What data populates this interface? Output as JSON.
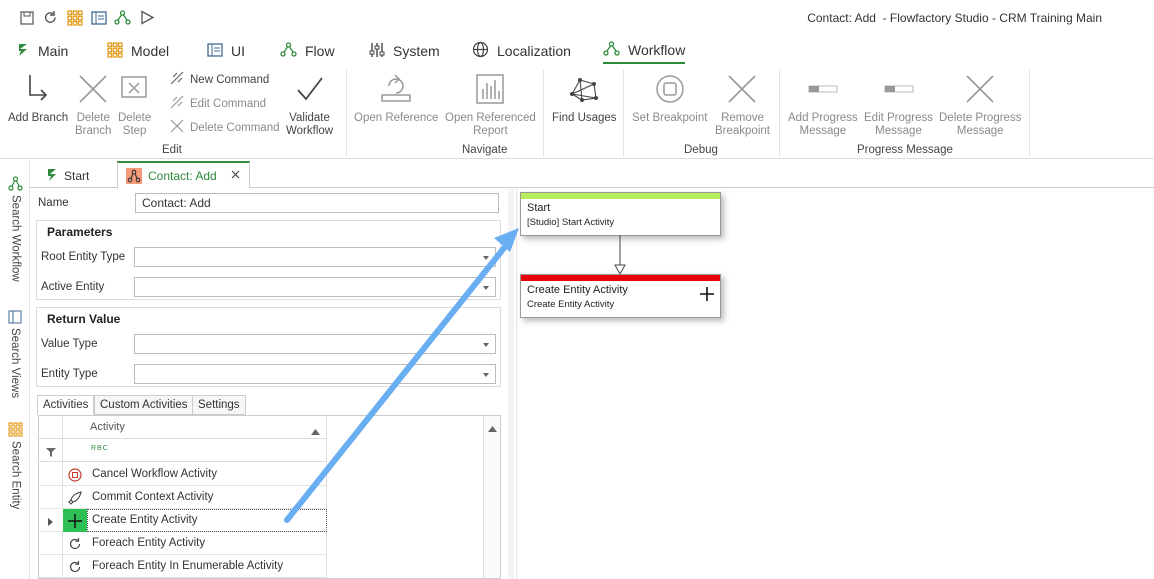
{
  "window": {
    "title": "Contact: Add  - Flowfactory Studio - CRM Training Main"
  },
  "quick_access": [
    "save-icon",
    "refresh-icon",
    "grid-icon",
    "view-icon",
    "flow-icon",
    "run-icon"
  ],
  "menu_tabs": [
    {
      "label": "Main",
      "icon": "main-icon"
    },
    {
      "label": "Model",
      "icon": "model-icon"
    },
    {
      "label": "UI",
      "icon": "ui-icon"
    },
    {
      "label": "Flow",
      "icon": "flow-icon"
    },
    {
      "label": "System",
      "icon": "system-icon"
    },
    {
      "label": "Localization",
      "icon": "globe-icon"
    },
    {
      "label": "Workflow",
      "icon": "workflow-icon",
      "active": true
    }
  ],
  "ribbon": {
    "add_branch": "Add Branch",
    "delete_branch": "Delete\nBranch",
    "delete_step": "Delete\nStep",
    "new_command": "New Command",
    "edit_command": "Edit Command",
    "delete_command": "Delete Command",
    "validate_workflow": "Validate\nWorkflow",
    "open_reference": "Open Reference",
    "open_referenced_report": "Open Referenced\nReport",
    "find_usages": "Find Usages",
    "set_breakpoint": "Set Breakpoint",
    "remove_breakpoint": "Remove\nBreakpoint",
    "add_progress": "Add Progress\nMessage",
    "edit_progress": "Edit Progress\nMessage",
    "delete_progress": "Delete Progress\nMessage",
    "groups": {
      "edit": "Edit",
      "navigate": "Navigate",
      "debug": "Debug",
      "progress": "Progress Message"
    }
  },
  "sidebar": {
    "search_workflow": "Search Workflow",
    "search_views": "Search Views",
    "search_entity": "Search Entity"
  },
  "doc_tabs": [
    {
      "label": "Start"
    },
    {
      "label": "Contact: Add",
      "active": true
    }
  ],
  "form": {
    "name_label": "Name",
    "name_value": "Contact: Add",
    "parameters": "Parameters",
    "root_entity_type": "Root Entity Type",
    "active_entity": "Active Entity",
    "return_value": "Return Value",
    "value_type": "Value Type",
    "entity_type": "Entity Type"
  },
  "bottom_tabs": [
    "Activities",
    "Custom Activities",
    "Settings"
  ],
  "grid": {
    "column": "Activity",
    "filter_glyph": "R B C",
    "rows": [
      {
        "label": "Cancel Workflow Activity",
        "icon": "cancel-icon"
      },
      {
        "label": "Commit Context Activity",
        "icon": "rocket-icon"
      },
      {
        "label": "Create Entity Activity",
        "icon": "plus-icon",
        "selected": true
      },
      {
        "label": "Foreach Entity Activity",
        "icon": "loop-icon"
      },
      {
        "label": "Foreach Entity In Enumerable Activity",
        "icon": "loop-icon"
      }
    ]
  },
  "canvas": {
    "nodes": [
      {
        "title": "Start",
        "subtitle": "[Studio] Start Activity",
        "color": "#b4ec5a"
      },
      {
        "title": "Create Entity Activity",
        "subtitle": "Create Entity Activity",
        "color": "#e8000d"
      }
    ]
  },
  "colors": {
    "accent": "#2e8b3c",
    "arrow": "#6aaef2"
  }
}
